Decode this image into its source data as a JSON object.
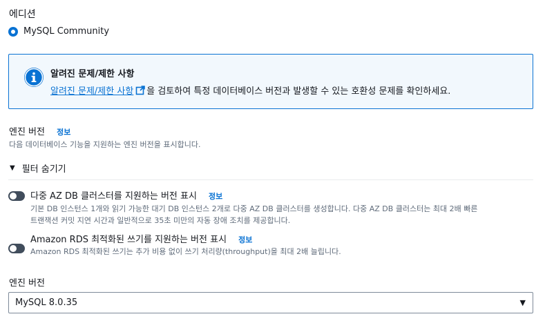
{
  "edition": {
    "label": "에디션",
    "option": "MySQL Community"
  },
  "info_box": {
    "title": "알려진 문제/제한 사항",
    "link_text": "알려진 문제/제한 사항",
    "body_text": "을 검토하여 특정 데이터베이스 버전과 발생할 수 있는 호환성 문제를 확인하세요."
  },
  "engine_version_header": {
    "title": "엔진 버전",
    "info": "정보",
    "description": "다음 데이터베이스 기능을 지원하는 엔진 버전을 표시합니다."
  },
  "filters": {
    "toggle_label": "필터 숨기기",
    "multi_az": {
      "label": "다중 AZ DB 클러스터를 지원하는 버전 표시",
      "info": "정보",
      "desc_line1": "기본 DB 인스턴스 1개와 읽기 가능한 대기 DB 인스턴스 2개로 다중 AZ DB 클러스터를 생성합니다. 다중 AZ DB 클러스터는 최대 2배 빠른",
      "desc_line2": "트랜잭션 커밋 지연 시간과 일반적으로 35초 미만의 자동 장애 조치를 제공합니다."
    },
    "optimized_writes": {
      "label": "Amazon RDS 최적화된 쓰기를 지원하는 버전 표시",
      "info": "정보",
      "desc": "Amazon RDS 최적화된 쓰기는 추가 비용 없이 쓰기 처리량(throughput)을 최대 2배 늘립니다."
    }
  },
  "engine_version_select": {
    "label": "엔진 버전",
    "value": "MySQL 8.0.35"
  },
  "colors": {
    "accent": "#0972d3",
    "info_bg": "#f2f8fd",
    "toggle_off": "#414d5c",
    "muted_text": "#5f6b7a"
  }
}
